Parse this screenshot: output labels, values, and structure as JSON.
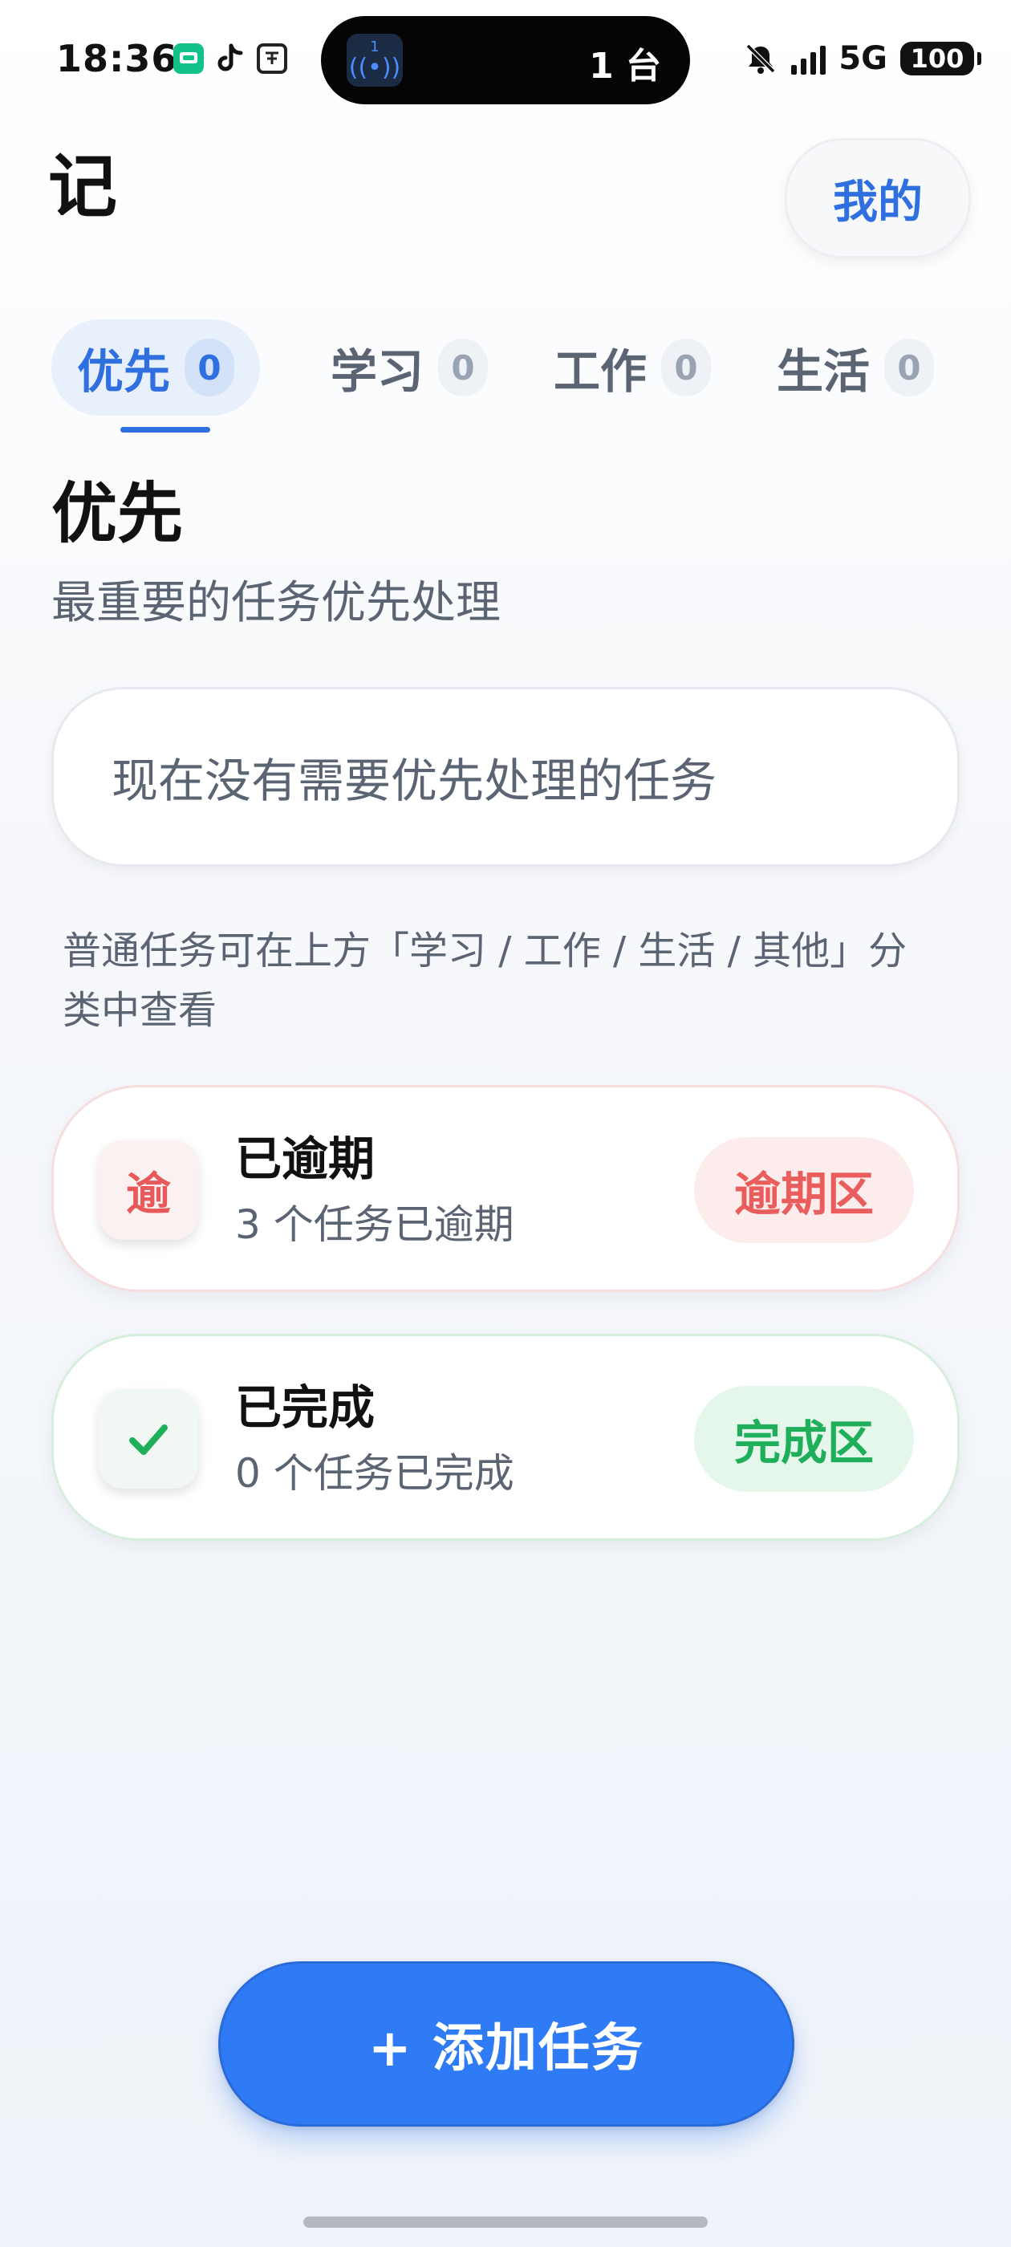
{
  "status_bar": {
    "time": "18:36",
    "island_icon_top": "1",
    "island_text": "1 台",
    "network": "5G",
    "battery": "100",
    "app_icons": [
      "wechat-icon",
      "tiktok-icon",
      "dictionary-icon"
    ]
  },
  "header": {
    "title": "记",
    "profile_label": "我的"
  },
  "tabs": [
    {
      "label": "优先",
      "count": "0",
      "active": true
    },
    {
      "label": "学习",
      "count": "0",
      "active": false
    },
    {
      "label": "工作",
      "count": "0",
      "active": false
    },
    {
      "label": "生活",
      "count": "0",
      "active": false
    }
  ],
  "section": {
    "title": "优先",
    "subtitle": "最重要的任务优先处理",
    "empty_text": "现在没有需要优先处理的任务",
    "hint": "普通任务可在上方「学习 / 工作 / 生活 / 其他」分类中查看"
  },
  "zones": {
    "overdue": {
      "icon_text": "逾",
      "title": "已逾期",
      "desc": "3 个任务已逾期",
      "button": "逾期区",
      "color": "#ea5d5d"
    },
    "done": {
      "icon": "check-icon",
      "title": "已完成",
      "desc": "0 个任务已完成",
      "button": "完成区",
      "color": "#1fae5a"
    }
  },
  "actions": {
    "add_task": "+ 添加任务"
  },
  "colors": {
    "accent": "#2f6fe0",
    "add_button": "#2f7bf6"
  }
}
